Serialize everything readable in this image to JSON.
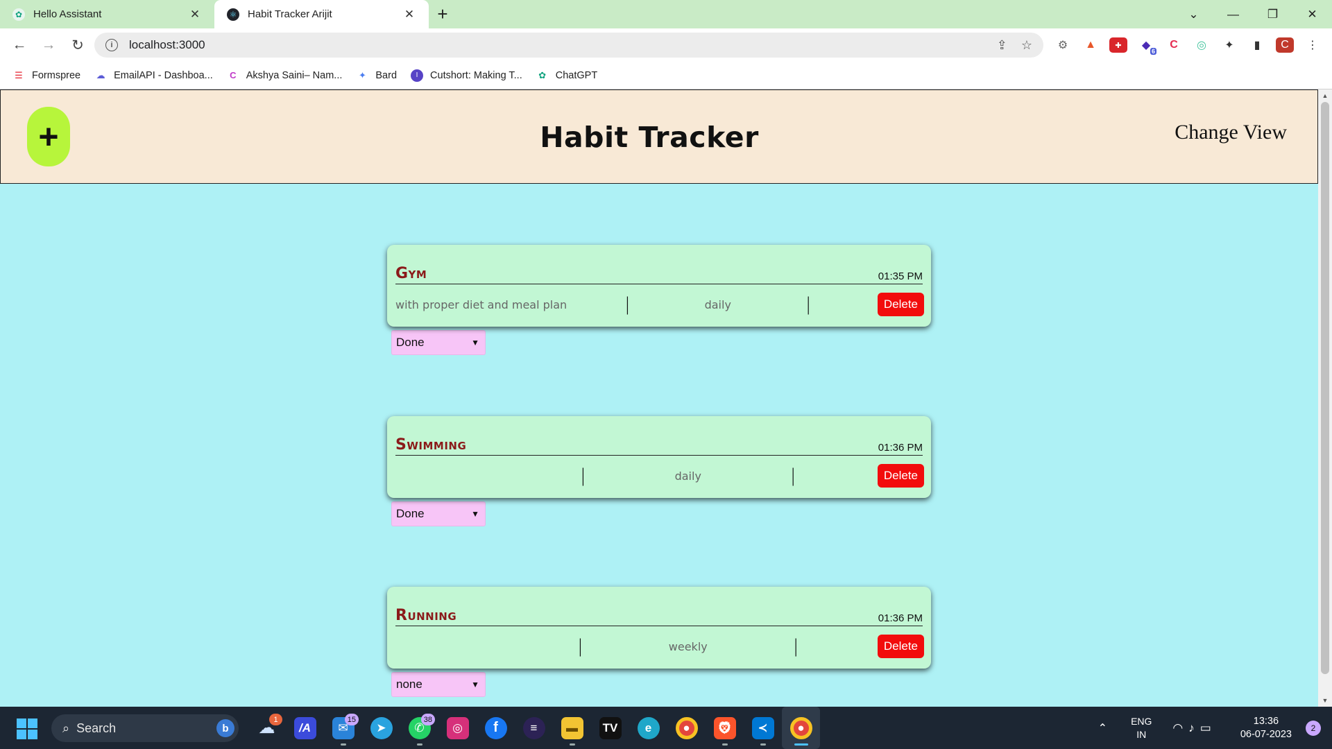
{
  "browser": {
    "tabs": [
      {
        "title": "Hello Assistant",
        "active": false
      },
      {
        "title": "Habit Tracker Arijit",
        "active": true
      }
    ],
    "new_tab": "+",
    "url": "localhost:3000",
    "bookmarks": [
      {
        "label": "Formspree",
        "color": "#e5232f"
      },
      {
        "label": "EmailAPI - Dashboa...",
        "color": "#5b5bd6"
      },
      {
        "label": "Akshya Saini– Nam...",
        "color": "#c039c8"
      },
      {
        "label": "Bard",
        "color": "#4a7cf0"
      },
      {
        "label": "Cutshort: Making T...",
        "color": "#5743c6"
      },
      {
        "label": "ChatGPT",
        "color": "#10a37f"
      }
    ],
    "extension_badge": "6",
    "profile_initial": "C"
  },
  "app": {
    "title": "Habit Tracker",
    "add_label": "+",
    "change_view_label": "Change View",
    "accent_add": "#b7f53b",
    "header_bg": "#f8e9d6",
    "page_bg": "#aef1f5",
    "card_bg": "#c2f7d4",
    "delete_color": "#f20c0c",
    "select_bg": "#f7c5f7"
  },
  "habits": [
    {
      "name": "Gym",
      "time": "01:35 PM",
      "description": "with proper diet and meal plan",
      "frequency": "daily",
      "delete_label": "Delete",
      "status": "Done"
    },
    {
      "name": "Swimming",
      "time": "01:36 PM",
      "description": "",
      "frequency": "daily",
      "delete_label": "Delete",
      "status": "Done"
    },
    {
      "name": "Running",
      "time": "01:36 PM",
      "description": "",
      "frequency": "weekly",
      "delete_label": "Delete",
      "status": "none"
    }
  ],
  "taskbar": {
    "search_label": "Search",
    "apps": [
      {
        "name": "weather-icon",
        "badge": "1"
      },
      {
        "name": "azure-icon",
        "badge": ""
      },
      {
        "name": "mail-icon",
        "badge": "15"
      },
      {
        "name": "telegram-icon",
        "badge": ""
      },
      {
        "name": "whatsapp-icon",
        "badge": "38"
      },
      {
        "name": "instagram-icon",
        "badge": ""
      },
      {
        "name": "facebook-icon",
        "badge": ""
      },
      {
        "name": "eclipse-icon",
        "badge": ""
      },
      {
        "name": "file-explorer-icon",
        "badge": ""
      },
      {
        "name": "tradingview-icon",
        "badge": ""
      },
      {
        "name": "edge-icon",
        "badge": ""
      },
      {
        "name": "chrome-icon",
        "badge": ""
      },
      {
        "name": "brave-icon",
        "badge": ""
      },
      {
        "name": "vscode-icon",
        "badge": ""
      },
      {
        "name": "chrome-profile-icon",
        "badge": ""
      }
    ],
    "lang_top": "ENG",
    "lang_bottom": "IN",
    "time": "13:36",
    "date": "06-07-2023",
    "notification_count": "2"
  }
}
